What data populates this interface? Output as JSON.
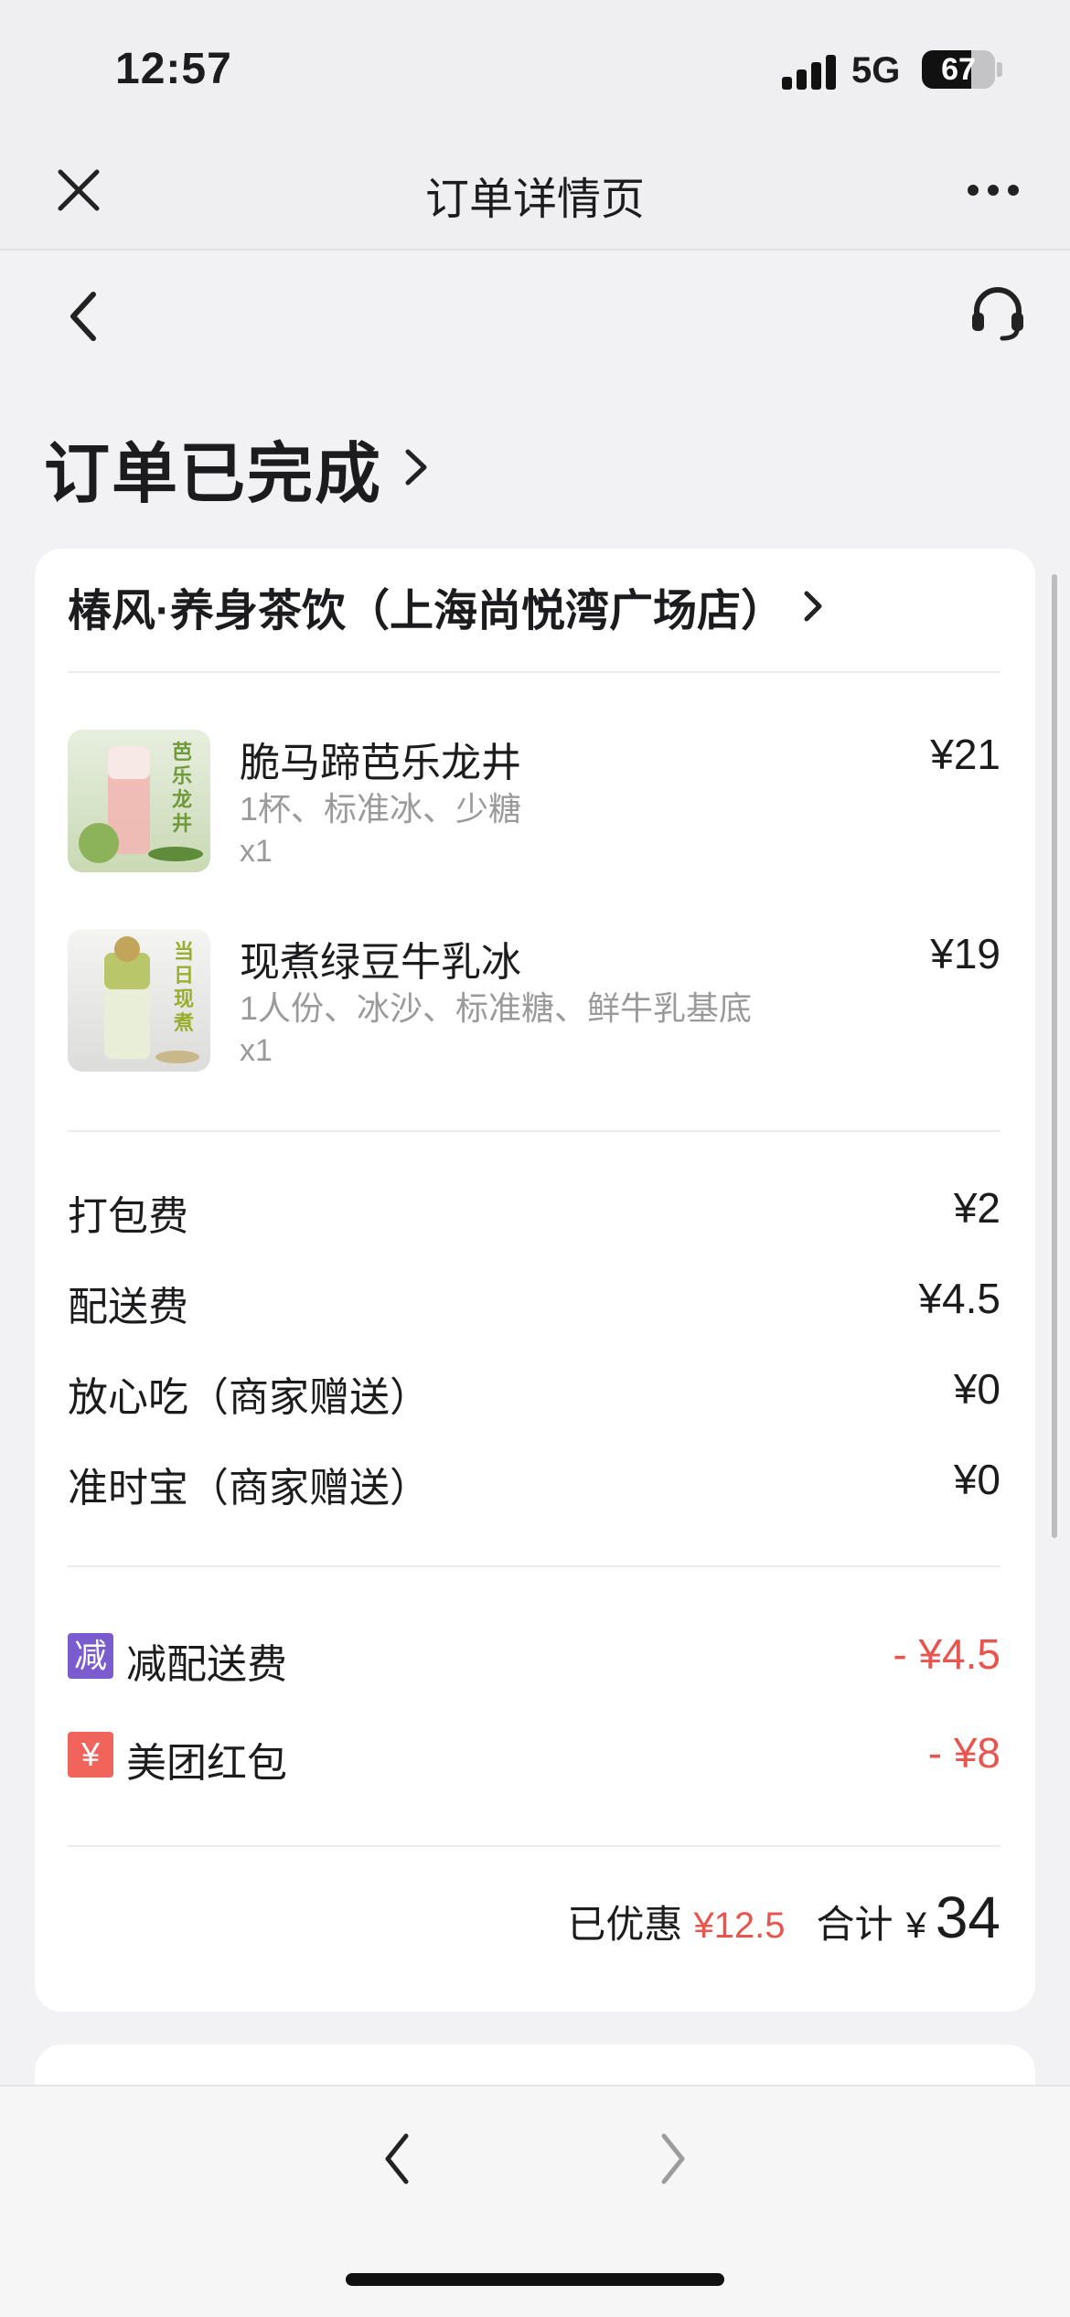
{
  "status_bar": {
    "time": "12:57",
    "network": "5G",
    "battery": "67",
    "battery_level": 0.67
  },
  "nav": {
    "title": "订单详情页"
  },
  "page": {
    "status_title": "订单已完成"
  },
  "shop": {
    "name": "椿风·养身茶饮（上海尚悦湾广场店）"
  },
  "items": [
    {
      "name": "脆马蹄芭乐龙井",
      "spec": "1杯、标准冰、少糖",
      "qty": "x1",
      "price": "¥21",
      "thumb_text": "芭乐龙井",
      "thumb_color": "#6f9a3a"
    },
    {
      "name": "现煮绿豆牛乳冰",
      "spec": "1人份、冰沙、标准糖、鲜牛乳基底",
      "qty": "x1",
      "price": "¥19",
      "thumb_text": "当日现煮",
      "thumb_color": "#9aae2e"
    }
  ],
  "fees": [
    {
      "label": "打包费",
      "value": "¥2"
    },
    {
      "label": "配送费",
      "value": "¥4.5"
    },
    {
      "label": "放心吃（商家赠送）",
      "value": "¥0"
    },
    {
      "label": "准时宝（商家赠送）",
      "value": "¥0"
    }
  ],
  "discounts": [
    {
      "tag": "减",
      "tag_color": "#7a5ccf",
      "label": "减配送费",
      "value": "- ¥4.5"
    },
    {
      "tag": "¥",
      "tag_color": "#f0645c",
      "label": "美团红包",
      "value": "- ¥8"
    }
  ],
  "summary": {
    "saved_label": "已优惠",
    "saved_amount": "¥12.5",
    "total_label": "合计",
    "currency": "¥",
    "total": "34"
  },
  "colors": {
    "accent_red": "#e8554e",
    "background": "#f2f2f4"
  }
}
